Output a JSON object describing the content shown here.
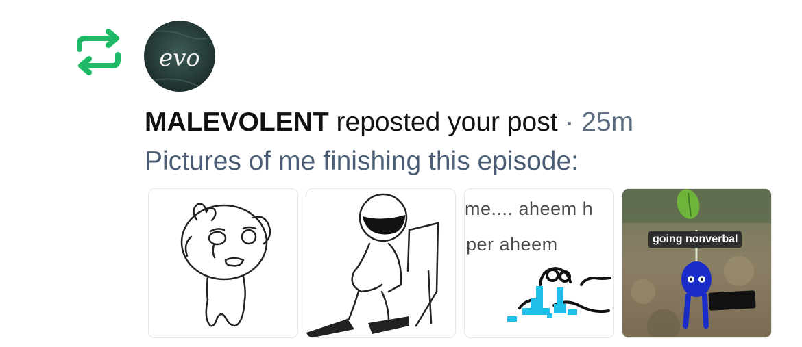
{
  "notification": {
    "type_icon": "repost-icon",
    "accent_color": "#1fb968",
    "user_name": "MALEVOLENT",
    "action_text": "reposted your post",
    "separator": "·",
    "time_ago": "25m",
    "avatar_text": "evo",
    "post_text": "Pictures of me finishing this episode:"
  },
  "images": [
    {
      "label": "crying-cartoon-face"
    },
    {
      "label": "sad-figure-in-chair"
    },
    {
      "label": "crying-meme",
      "text_line1": "me.... aheem h",
      "text_line2": "per  aheem"
    },
    {
      "label": "blue-pikmin",
      "caption": "going nonverbal"
    }
  ]
}
